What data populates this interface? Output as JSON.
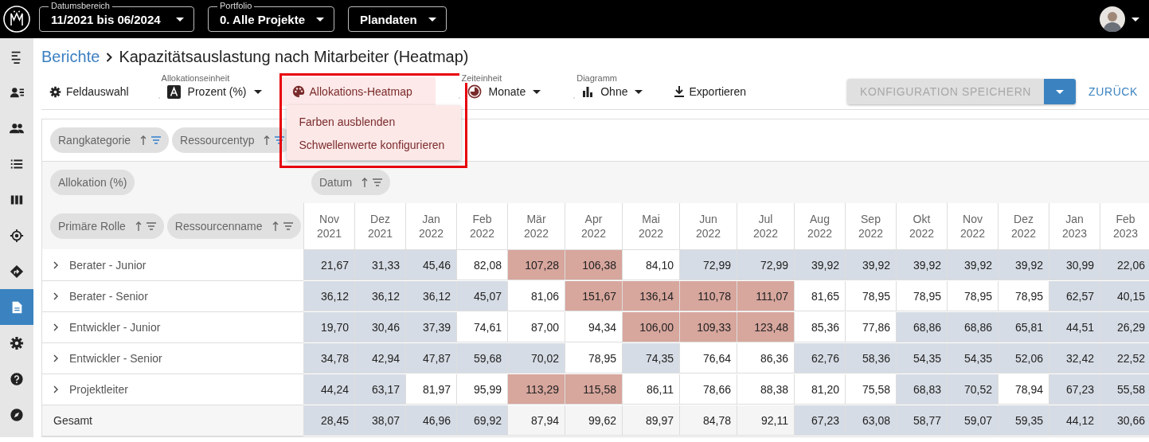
{
  "topbar": {
    "selects": [
      {
        "label": "Datumsbereich",
        "value": "11/2021 bis 06/2024"
      },
      {
        "label": "Portfolio",
        "value": "0. Alle Projekte"
      },
      {
        "value": "Plandaten"
      }
    ]
  },
  "sidebar": {
    "items": [
      {
        "kind": "menu",
        "selected": false
      },
      {
        "kind": "person-list",
        "selected": false
      },
      {
        "kind": "people",
        "selected": false
      },
      {
        "kind": "list",
        "selected": false
      },
      {
        "kind": "columns",
        "selected": false
      },
      {
        "kind": "target",
        "selected": false
      },
      {
        "kind": "direction",
        "selected": false
      },
      {
        "kind": "document",
        "selected": true
      },
      {
        "kind": "settings",
        "selected": false
      },
      {
        "kind": "help",
        "selected": false
      },
      {
        "kind": "compass",
        "selected": false
      }
    ]
  },
  "breadcrumb": {
    "parent": "Berichte",
    "title": "Kapazitätsauslastung nach Mitarbeiter (Heatmap)"
  },
  "toolbar": {
    "field_selection": {
      "label": "Feldauswahl"
    },
    "allocation_unit": {
      "label": "Allokationseinheit",
      "value": "Prozent (%)"
    },
    "heatmap": {
      "label": "Allokations-Heatmap",
      "expanded": true,
      "menu": [
        "Farben ausblenden",
        "Schwellenwerte konfigurieren"
      ]
    },
    "time_unit": {
      "label": "Zeiteinheit",
      "value": "Monate"
    },
    "chart_type": {
      "label": "Diagramm",
      "value": "Ohne"
    },
    "export": {
      "label": "Exportieren"
    },
    "save": {
      "label": "KONFIGURATION SPEICHERN",
      "disabled": true
    },
    "back": {
      "label": "ZURÜCK"
    }
  },
  "pivot": {
    "filter_fields": [
      {
        "label": "Rangkategorie",
        "filtered": true
      },
      {
        "label": "Ressourcentyp",
        "filtered": true
      }
    ],
    "value_fields": [
      {
        "label": "Allokation (%)"
      }
    ],
    "column_fields": [
      {
        "label": "Datum",
        "filtered": false
      }
    ],
    "row_fields": [
      {
        "label": "Primäre Rolle",
        "filtered": false
      },
      {
        "label": "Ressourcenname",
        "filtered": false
      }
    ],
    "columns": [
      {
        "month": "Nov",
        "year": "2021"
      },
      {
        "month": "Dez",
        "year": "2021"
      },
      {
        "month": "Jan",
        "year": "2022"
      },
      {
        "month": "Feb",
        "year": "2022"
      },
      {
        "month": "Mär",
        "year": "2022"
      },
      {
        "month": "Apr",
        "year": "2022"
      },
      {
        "month": "Mai",
        "year": "2022"
      },
      {
        "month": "Jun",
        "year": "2022"
      },
      {
        "month": "Jul",
        "year": "2022"
      },
      {
        "month": "Aug",
        "year": "2022"
      },
      {
        "month": "Sep",
        "year": "2022"
      },
      {
        "month": "Okt",
        "year": "2022"
      },
      {
        "month": "Nov",
        "year": "2022"
      },
      {
        "month": "Dez",
        "year": "2022"
      },
      {
        "month": "Jan",
        "year": "2023"
      },
      {
        "month": "Feb",
        "year": "2023"
      }
    ],
    "rows": [
      {
        "label": "Berater - Junior",
        "kind": "group",
        "cells": [
          {
            "value": "21,67",
            "color": "#d6dce5"
          },
          {
            "value": "31,33",
            "color": "#d6dce5"
          },
          {
            "value": "45,46",
            "color": "#d6dce5"
          },
          {
            "value": "82,08",
            "color": "#ffffff"
          },
          {
            "value": "107,28",
            "color": "#d7a69d"
          },
          {
            "value": "106,38",
            "color": "#d7a69d"
          },
          {
            "value": "84,10",
            "color": "#ffffff"
          },
          {
            "value": "72,99",
            "color": "#d6dce5"
          },
          {
            "value": "72,99",
            "color": "#d6dce5"
          },
          {
            "value": "39,92",
            "color": "#d6dce5"
          },
          {
            "value": "39,92",
            "color": "#d6dce5"
          },
          {
            "value": "39,92",
            "color": "#d6dce5"
          },
          {
            "value": "39,92",
            "color": "#d6dce5"
          },
          {
            "value": "39,92",
            "color": "#d6dce5"
          },
          {
            "value": "30,99",
            "color": "#d6dce5"
          },
          {
            "value": "22,06",
            "color": "#d6dce5"
          }
        ]
      },
      {
        "label": "Berater - Senior",
        "kind": "group",
        "cells": [
          {
            "value": "36,12",
            "color": "#d6dce5"
          },
          {
            "value": "36,12",
            "color": "#d6dce5"
          },
          {
            "value": "36,12",
            "color": "#d6dce5"
          },
          {
            "value": "45,07",
            "color": "#d6dce5"
          },
          {
            "value": "81,06",
            "color": "#ffffff"
          },
          {
            "value": "151,67",
            "color": "#d7a69d"
          },
          {
            "value": "136,14",
            "color": "#d7a69d"
          },
          {
            "value": "110,78",
            "color": "#d7a69d"
          },
          {
            "value": "111,07",
            "color": "#d7a69d"
          },
          {
            "value": "81,65",
            "color": "#ffffff"
          },
          {
            "value": "78,95",
            "color": "#ffffff"
          },
          {
            "value": "78,95",
            "color": "#ffffff"
          },
          {
            "value": "78,95",
            "color": "#ffffff"
          },
          {
            "value": "78,95",
            "color": "#ffffff"
          },
          {
            "value": "62,57",
            "color": "#d6dce5"
          },
          {
            "value": "40,15",
            "color": "#d6dce5"
          }
        ]
      },
      {
        "label": "Entwickler - Junior",
        "kind": "group",
        "cells": [
          {
            "value": "19,70",
            "color": "#d6dce5"
          },
          {
            "value": "30,46",
            "color": "#d6dce5"
          },
          {
            "value": "37,39",
            "color": "#d6dce5"
          },
          {
            "value": "74,61",
            "color": "#ffffff"
          },
          {
            "value": "87,00",
            "color": "#ffffff"
          },
          {
            "value": "94,34",
            "color": "#ffffff"
          },
          {
            "value": "106,00",
            "color": "#d7a69d"
          },
          {
            "value": "109,33",
            "color": "#d7a69d"
          },
          {
            "value": "123,48",
            "color": "#d7a69d"
          },
          {
            "value": "85,36",
            "color": "#ffffff"
          },
          {
            "value": "77,86",
            "color": "#ffffff"
          },
          {
            "value": "68,86",
            "color": "#d6dce5"
          },
          {
            "value": "68,86",
            "color": "#d6dce5"
          },
          {
            "value": "65,81",
            "color": "#d6dce5"
          },
          {
            "value": "44,51",
            "color": "#d6dce5"
          },
          {
            "value": "26,29",
            "color": "#d6dce5"
          }
        ]
      },
      {
        "label": "Entwickler - Senior",
        "kind": "group",
        "cells": [
          {
            "value": "34,78",
            "color": "#d6dce5"
          },
          {
            "value": "42,94",
            "color": "#d6dce5"
          },
          {
            "value": "47,87",
            "color": "#d6dce5"
          },
          {
            "value": "59,68",
            "color": "#d6dce5"
          },
          {
            "value": "70,02",
            "color": "#d6dce5"
          },
          {
            "value": "78,95",
            "color": "#ffffff"
          },
          {
            "value": "74,35",
            "color": "#d6dce5"
          },
          {
            "value": "76,64",
            "color": "#ffffff"
          },
          {
            "value": "86,36",
            "color": "#ffffff"
          },
          {
            "value": "62,76",
            "color": "#d6dce5"
          },
          {
            "value": "58,36",
            "color": "#d6dce5"
          },
          {
            "value": "54,35",
            "color": "#d6dce5"
          },
          {
            "value": "54,35",
            "color": "#d6dce5"
          },
          {
            "value": "52,06",
            "color": "#d6dce5"
          },
          {
            "value": "32,42",
            "color": "#d6dce5"
          },
          {
            "value": "22,52",
            "color": "#d6dce5"
          }
        ]
      },
      {
        "label": "Projektleiter",
        "kind": "group",
        "cells": [
          {
            "value": "44,24",
            "color": "#d6dce5"
          },
          {
            "value": "63,17",
            "color": "#d6dce5"
          },
          {
            "value": "81,97",
            "color": "#ffffff"
          },
          {
            "value": "95,99",
            "color": "#ffffff"
          },
          {
            "value": "113,29",
            "color": "#d7a69d"
          },
          {
            "value": "115,58",
            "color": "#d7a69d"
          },
          {
            "value": "86,11",
            "color": "#ffffff"
          },
          {
            "value": "78,66",
            "color": "#ffffff"
          },
          {
            "value": "88,38",
            "color": "#ffffff"
          },
          {
            "value": "81,20",
            "color": "#ffffff"
          },
          {
            "value": "75,58",
            "color": "#ffffff"
          },
          {
            "value": "68,83",
            "color": "#d6dce5"
          },
          {
            "value": "70,52",
            "color": "#d6dce5"
          },
          {
            "value": "78,94",
            "color": "#ffffff"
          },
          {
            "value": "67,23",
            "color": "#d6dce5"
          },
          {
            "value": "55,58",
            "color": "#d6dce5"
          }
        ]
      },
      {
        "label": "Gesamt",
        "kind": "total",
        "cells": [
          {
            "value": "28,45",
            "color": "#d6dce5"
          },
          {
            "value": "38,07",
            "color": "#d6dce5"
          },
          {
            "value": "46,96",
            "color": "#d6dce5"
          },
          {
            "value": "69,92",
            "color": "#d6dce5"
          },
          {
            "value": "87,94",
            "color": "#f5f5f5"
          },
          {
            "value": "99,62",
            "color": "#f5f5f5"
          },
          {
            "value": "89,97",
            "color": "#f5f5f5"
          },
          {
            "value": "84,78",
            "color": "#f5f5f5"
          },
          {
            "value": "92,11",
            "color": "#f5f5f5"
          },
          {
            "value": "67,23",
            "color": "#d6dce5"
          },
          {
            "value": "63,08",
            "color": "#d6dce5"
          },
          {
            "value": "58,77",
            "color": "#d6dce5"
          },
          {
            "value": "59,07",
            "color": "#d6dce5"
          },
          {
            "value": "59,35",
            "color": "#d6dce5"
          },
          {
            "value": "44,12",
            "color": "#d6dce5"
          },
          {
            "value": "30,66",
            "color": "#d6dce5"
          }
        ]
      }
    ]
  }
}
